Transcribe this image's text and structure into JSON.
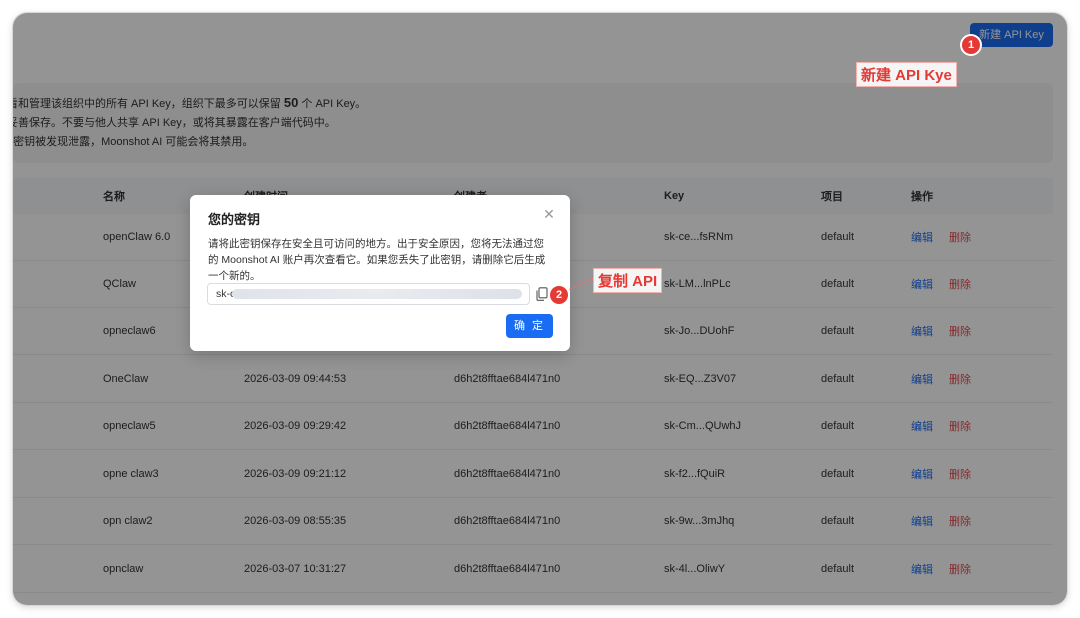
{
  "header": {
    "new_key_button": "新建 API Key"
  },
  "info": {
    "line1_pre": "看和管理该组织中的所有 API Key，组织下最多可以保留 ",
    "line1_bold": "50",
    "line1_post": " 个 API Key。",
    "line2": "妥善保存。不要与他人共享 API Key，或将其暴露在客户端代码中。",
    "line3": "I 密钥被发现泄露，Moonshot AI 可能会将其禁用。"
  },
  "table": {
    "columns": {
      "name": "名称",
      "time": "创建时间",
      "creator": "创建者",
      "key": "Key",
      "project": "项目",
      "ops": "操作"
    },
    "edit_label": "编辑",
    "delete_label": "删除",
    "rows": [
      {
        "name": "openClaw 6.0",
        "time": "",
        "creator": "",
        "key": "sk-ce...fsRNm",
        "project": "default"
      },
      {
        "name": "QClaw",
        "time": "",
        "creator": "",
        "key": "sk-LM...lnPLc",
        "project": "default"
      },
      {
        "name": "opneclaw6",
        "time": "",
        "creator": "",
        "key": "sk-Jo...DUohF",
        "project": "default"
      },
      {
        "name": "OneClaw",
        "time": "2026-03-09 09:44:53",
        "creator": "d6h2t8fftae684l471n0",
        "key": "sk-EQ...Z3V07",
        "project": "default"
      },
      {
        "name": "opneclaw5",
        "time": "2026-03-09 09:29:42",
        "creator": "d6h2t8fftae684l471n0",
        "key": "sk-Cm...QUwhJ",
        "project": "default"
      },
      {
        "name": "opne claw3",
        "time": "2026-03-09 09:21:12",
        "creator": "d6h2t8fftae684l471n0",
        "key": "sk-f2...fQuiR",
        "project": "default"
      },
      {
        "name": "opn claw2",
        "time": "2026-03-09 08:55:35",
        "creator": "d6h2t8fftae684l471n0",
        "key": "sk-9w...3mJhq",
        "project": "default"
      },
      {
        "name": "opnclaw",
        "time": "2026-03-07 10:31:27",
        "creator": "d6h2t8fftae684l471n0",
        "key": "sk-4l...OliwY",
        "project": "default"
      }
    ]
  },
  "modal": {
    "title": "您的密钥",
    "description": "请将此密钥保存在安全且可访问的地方。出于安全原因，您将无法通过您的 Moonshot AI 账户再次查看它。如果您丢失了此密钥，请删除它后生成一个新的。",
    "key_value": "sk-c",
    "confirm_button": "确 定",
    "close_icon": "close-icon",
    "copy_icon": "copy-icon"
  },
  "annotations": {
    "badge1": "1",
    "label1": "新建 API Kye",
    "badge2": "2",
    "label2": "复制 API",
    "color": "#e53935"
  }
}
